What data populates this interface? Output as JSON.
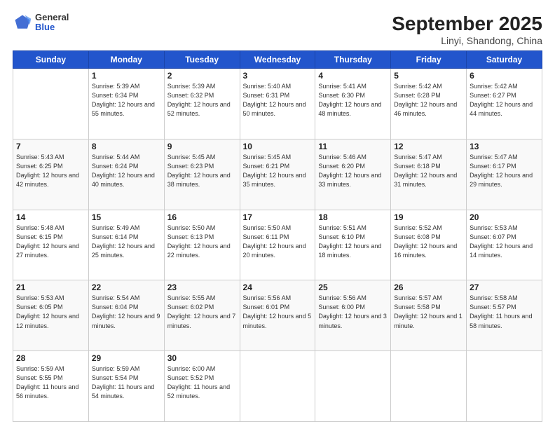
{
  "header": {
    "logo_general": "General",
    "logo_blue": "Blue",
    "title": "September 2025",
    "subtitle": "Linyi, Shandong, China"
  },
  "days_of_week": [
    "Sunday",
    "Monday",
    "Tuesday",
    "Wednesday",
    "Thursday",
    "Friday",
    "Saturday"
  ],
  "weeks": [
    [
      {
        "day": "",
        "sunrise": "",
        "sunset": "",
        "daylight": ""
      },
      {
        "day": "1",
        "sunrise": "Sunrise: 5:39 AM",
        "sunset": "Sunset: 6:34 PM",
        "daylight": "Daylight: 12 hours and 55 minutes."
      },
      {
        "day": "2",
        "sunrise": "Sunrise: 5:39 AM",
        "sunset": "Sunset: 6:32 PM",
        "daylight": "Daylight: 12 hours and 52 minutes."
      },
      {
        "day": "3",
        "sunrise": "Sunrise: 5:40 AM",
        "sunset": "Sunset: 6:31 PM",
        "daylight": "Daylight: 12 hours and 50 minutes."
      },
      {
        "day": "4",
        "sunrise": "Sunrise: 5:41 AM",
        "sunset": "Sunset: 6:30 PM",
        "daylight": "Daylight: 12 hours and 48 minutes."
      },
      {
        "day": "5",
        "sunrise": "Sunrise: 5:42 AM",
        "sunset": "Sunset: 6:28 PM",
        "daylight": "Daylight: 12 hours and 46 minutes."
      },
      {
        "day": "6",
        "sunrise": "Sunrise: 5:42 AM",
        "sunset": "Sunset: 6:27 PM",
        "daylight": "Daylight: 12 hours and 44 minutes."
      }
    ],
    [
      {
        "day": "7",
        "sunrise": "Sunrise: 5:43 AM",
        "sunset": "Sunset: 6:25 PM",
        "daylight": "Daylight: 12 hours and 42 minutes."
      },
      {
        "day": "8",
        "sunrise": "Sunrise: 5:44 AM",
        "sunset": "Sunset: 6:24 PM",
        "daylight": "Daylight: 12 hours and 40 minutes."
      },
      {
        "day": "9",
        "sunrise": "Sunrise: 5:45 AM",
        "sunset": "Sunset: 6:23 PM",
        "daylight": "Daylight: 12 hours and 38 minutes."
      },
      {
        "day": "10",
        "sunrise": "Sunrise: 5:45 AM",
        "sunset": "Sunset: 6:21 PM",
        "daylight": "Daylight: 12 hours and 35 minutes."
      },
      {
        "day": "11",
        "sunrise": "Sunrise: 5:46 AM",
        "sunset": "Sunset: 6:20 PM",
        "daylight": "Daylight: 12 hours and 33 minutes."
      },
      {
        "day": "12",
        "sunrise": "Sunrise: 5:47 AM",
        "sunset": "Sunset: 6:18 PM",
        "daylight": "Daylight: 12 hours and 31 minutes."
      },
      {
        "day": "13",
        "sunrise": "Sunrise: 5:47 AM",
        "sunset": "Sunset: 6:17 PM",
        "daylight": "Daylight: 12 hours and 29 minutes."
      }
    ],
    [
      {
        "day": "14",
        "sunrise": "Sunrise: 5:48 AM",
        "sunset": "Sunset: 6:15 PM",
        "daylight": "Daylight: 12 hours and 27 minutes."
      },
      {
        "day": "15",
        "sunrise": "Sunrise: 5:49 AM",
        "sunset": "Sunset: 6:14 PM",
        "daylight": "Daylight: 12 hours and 25 minutes."
      },
      {
        "day": "16",
        "sunrise": "Sunrise: 5:50 AM",
        "sunset": "Sunset: 6:13 PM",
        "daylight": "Daylight: 12 hours and 22 minutes."
      },
      {
        "day": "17",
        "sunrise": "Sunrise: 5:50 AM",
        "sunset": "Sunset: 6:11 PM",
        "daylight": "Daylight: 12 hours and 20 minutes."
      },
      {
        "day": "18",
        "sunrise": "Sunrise: 5:51 AM",
        "sunset": "Sunset: 6:10 PM",
        "daylight": "Daylight: 12 hours and 18 minutes."
      },
      {
        "day": "19",
        "sunrise": "Sunrise: 5:52 AM",
        "sunset": "Sunset: 6:08 PM",
        "daylight": "Daylight: 12 hours and 16 minutes."
      },
      {
        "day": "20",
        "sunrise": "Sunrise: 5:53 AM",
        "sunset": "Sunset: 6:07 PM",
        "daylight": "Daylight: 12 hours and 14 minutes."
      }
    ],
    [
      {
        "day": "21",
        "sunrise": "Sunrise: 5:53 AM",
        "sunset": "Sunset: 6:05 PM",
        "daylight": "Daylight: 12 hours and 12 minutes."
      },
      {
        "day": "22",
        "sunrise": "Sunrise: 5:54 AM",
        "sunset": "Sunset: 6:04 PM",
        "daylight": "Daylight: 12 hours and 9 minutes."
      },
      {
        "day": "23",
        "sunrise": "Sunrise: 5:55 AM",
        "sunset": "Sunset: 6:02 PM",
        "daylight": "Daylight: 12 hours and 7 minutes."
      },
      {
        "day": "24",
        "sunrise": "Sunrise: 5:56 AM",
        "sunset": "Sunset: 6:01 PM",
        "daylight": "Daylight: 12 hours and 5 minutes."
      },
      {
        "day": "25",
        "sunrise": "Sunrise: 5:56 AM",
        "sunset": "Sunset: 6:00 PM",
        "daylight": "Daylight: 12 hours and 3 minutes."
      },
      {
        "day": "26",
        "sunrise": "Sunrise: 5:57 AM",
        "sunset": "Sunset: 5:58 PM",
        "daylight": "Daylight: 12 hours and 1 minute."
      },
      {
        "day": "27",
        "sunrise": "Sunrise: 5:58 AM",
        "sunset": "Sunset: 5:57 PM",
        "daylight": "Daylight: 11 hours and 58 minutes."
      }
    ],
    [
      {
        "day": "28",
        "sunrise": "Sunrise: 5:59 AM",
        "sunset": "Sunset: 5:55 PM",
        "daylight": "Daylight: 11 hours and 56 minutes."
      },
      {
        "day": "29",
        "sunrise": "Sunrise: 5:59 AM",
        "sunset": "Sunset: 5:54 PM",
        "daylight": "Daylight: 11 hours and 54 minutes."
      },
      {
        "day": "30",
        "sunrise": "Sunrise: 6:00 AM",
        "sunset": "Sunset: 5:52 PM",
        "daylight": "Daylight: 11 hours and 52 minutes."
      },
      {
        "day": "",
        "sunrise": "",
        "sunset": "",
        "daylight": ""
      },
      {
        "day": "",
        "sunrise": "",
        "sunset": "",
        "daylight": ""
      },
      {
        "day": "",
        "sunrise": "",
        "sunset": "",
        "daylight": ""
      },
      {
        "day": "",
        "sunrise": "",
        "sunset": "",
        "daylight": ""
      }
    ]
  ]
}
